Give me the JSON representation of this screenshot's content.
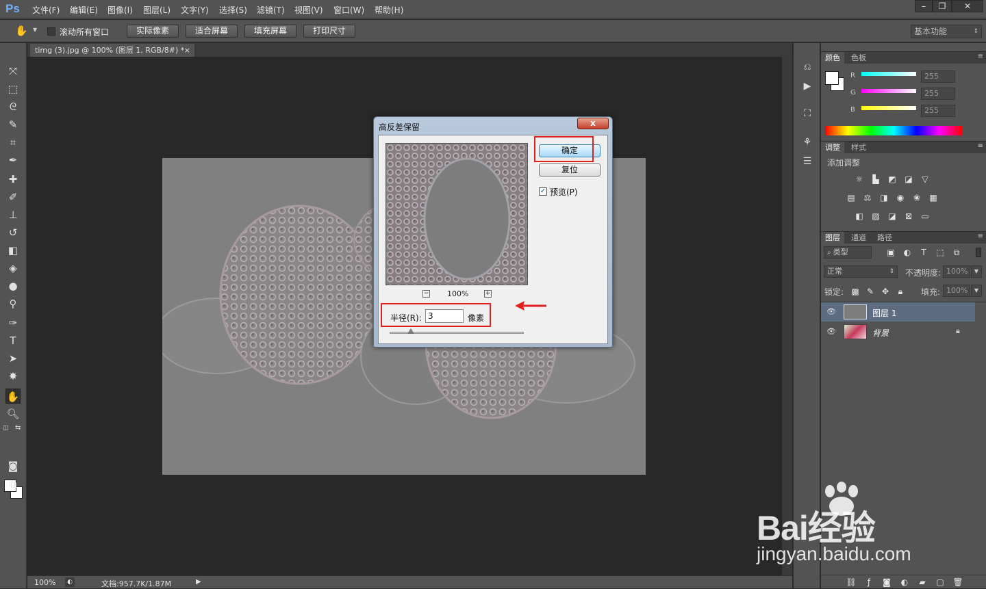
{
  "app": {
    "logo": "Ps"
  },
  "menu": [
    "文件(F)",
    "编辑(E)",
    "图像(I)",
    "图层(L)",
    "文字(Y)",
    "选择(S)",
    "滤镜(T)",
    "视图(V)",
    "窗口(W)",
    "帮助(H)"
  ],
  "window_controls": {
    "minimize": "–",
    "restore": "❐",
    "close": "✕"
  },
  "options_bar": {
    "scroll_all_label": "滚动所有窗口",
    "actual_pixels": "实际像素",
    "fit_screen": "适合屏幕",
    "fill_screen": "填充屏幕",
    "print_size": "打印尺寸",
    "workspace": "基本功能"
  },
  "document": {
    "tab_title": "timg (3).jpg @ 100% (图层 1, RGB/8#) *",
    "tab_close": "×"
  },
  "status": {
    "zoom": "100%",
    "doc_info": "文档:957.7K/1.87M"
  },
  "color_panel": {
    "tabs": [
      "颜色",
      "色板"
    ],
    "channels": [
      {
        "label": "R",
        "value": "255"
      },
      {
        "label": "G",
        "value": "255"
      },
      {
        "label": "B",
        "value": "255"
      }
    ]
  },
  "adjust_panel": {
    "tabs": [
      "调整",
      "样式"
    ],
    "heading": "添加调整"
  },
  "layers_panel": {
    "tabs": [
      "图层",
      "通道",
      "路径"
    ],
    "filter_kind": "类型",
    "blend_mode": "正常",
    "opacity_label": "不透明度:",
    "opacity_value": "100%",
    "lock_label": "锁定:",
    "fill_label": "填充:",
    "fill_value": "100%",
    "layers": [
      {
        "name": "图层 1",
        "selected": true
      },
      {
        "name": "背景",
        "selected": false,
        "locked": true
      }
    ]
  },
  "dialog": {
    "title": "高反差保留",
    "close": "x",
    "ok": "确定",
    "reset": "复位",
    "preview_label": "预览(P)",
    "preview_checked": true,
    "zoom_value": "100%",
    "zoom_out": "−",
    "zoom_in": "+",
    "radius_label": "半径(R):",
    "radius_value": "3",
    "radius_unit": "像素"
  },
  "watermark": {
    "brand": "Bai经验",
    "url": "jingyan.baidu.com"
  },
  "colors": {
    "accent_red": "#e0201c",
    "selected_layer": "#5d6c80"
  }
}
